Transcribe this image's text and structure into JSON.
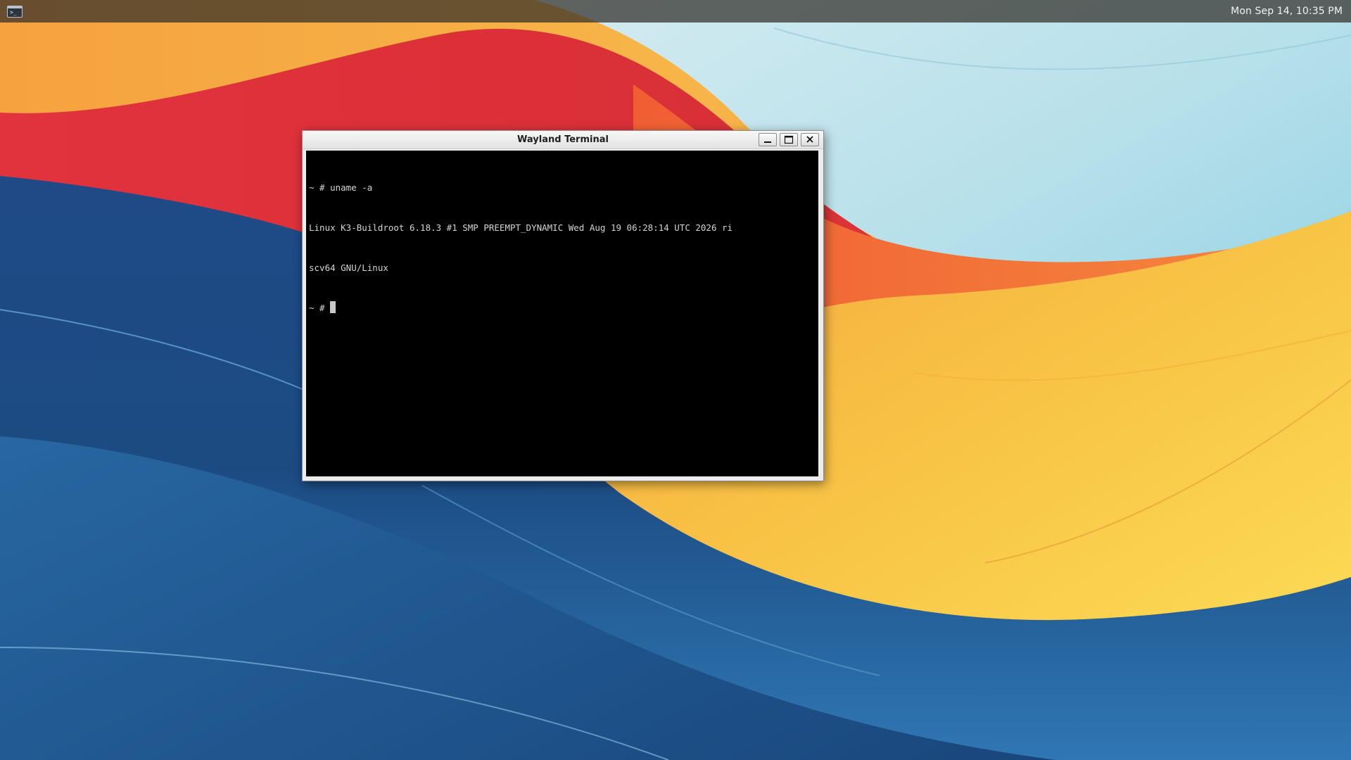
{
  "panel": {
    "clock": "Mon Sep 14, 10:35 PM",
    "launcher_icon": "terminal-app-icon"
  },
  "window": {
    "title": "Wayland Terminal",
    "buttons": {
      "minimize_icon": "minimize-icon",
      "maximize_icon": "maximize-icon",
      "close_icon": "close-icon"
    }
  },
  "terminal": {
    "lines": [
      "~ # uname -a",
      "Linux K3-Buildroot 6.18.3 #1 SMP PREEMPT_DYNAMIC Wed Aug 19 06:28:14 UTC 2026 ri",
      "scv64 GNU/Linux"
    ],
    "prompt": "~ # ",
    "background": "#000000",
    "foreground": "#d4d4d4"
  },
  "colors": {
    "panel_bg": "#302e28",
    "wallpaper_blue": "#1d4f86",
    "wallpaper_red": "#d9343d",
    "wallpaper_orange": "#f07a3c",
    "wallpaper_yellow": "#f8c94a",
    "wallpaper_sky": "#a8dbe8"
  }
}
